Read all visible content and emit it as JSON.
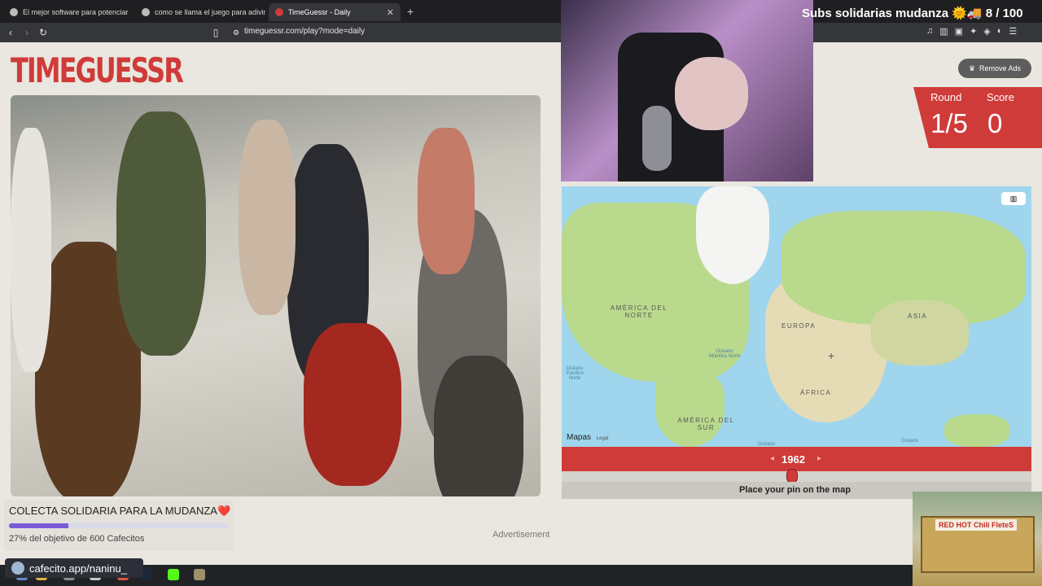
{
  "browser": {
    "tabs": [
      {
        "label": "El mejor software para potenciar"
      },
      {
        "label": "como se llama el juego para adivinar"
      },
      {
        "label": "TimeGuessr - Daily"
      }
    ],
    "add_tab": "+",
    "url": "timeguessr.com/play?mode=daily"
  },
  "stream": {
    "title": "Subs solidarias mudanza 🌞🚚 8 / 100"
  },
  "game": {
    "logo": "TIMEGUESSR",
    "remove_ads": "Remove Ads",
    "round_label": "Round",
    "round_value": "1/5",
    "score_label": "Score",
    "score_value": "0",
    "year": "1962",
    "year_prev": "◂",
    "year_next": "▸",
    "pin_instruction": "Place your pin on the map",
    "map": {
      "labels": {
        "na": "AMÉRICA DEL NORTE",
        "europe": "EUROPA",
        "asia": "ASIA",
        "africa": "ÁFRICA",
        "sa": "AMÉRICA DEL SUR"
      },
      "oceans": {
        "atl": "Océano Atlántico Norte",
        "pac": "Océano Pacífico Norte",
        "oc1": "Océano",
        "oc2": "Océano"
      },
      "attribution": "Mapas",
      "legal": "Legal"
    }
  },
  "donation": {
    "title": "COLECTA SOLIDARIA PARA LA MUDANZA❤️",
    "progress_pct": 27,
    "subtitle": "27% del objetivo de 600 Cafecitos",
    "link": "cafecito.app/naninu_"
  },
  "advertisement": "Advertisement",
  "overlay": {
    "truck_sign": "RED HOT Chili FleteS"
  }
}
